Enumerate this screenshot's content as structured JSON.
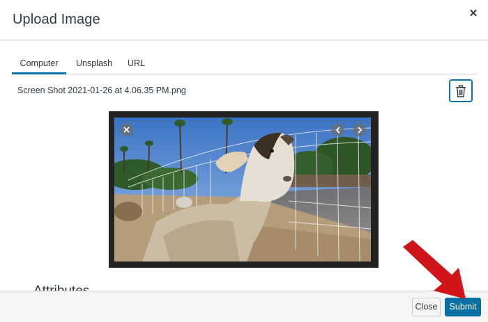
{
  "dialog": {
    "title": "Upload Image",
    "close_icon": "close-icon"
  },
  "tabs": [
    {
      "label": "Computer",
      "active": true
    },
    {
      "label": "Unsplash",
      "active": false
    },
    {
      "label": "URL",
      "active": false
    }
  ],
  "file": {
    "name": "Screen Shot 2021-01-26 at 4.06.35 PM.png",
    "delete_icon": "trash-icon"
  },
  "preview": {
    "controls": [
      "close-icon",
      "chevron-left-icon",
      "chevron-right-icon"
    ]
  },
  "section": {
    "heading": "Attributes"
  },
  "footer": {
    "close_label": "Close",
    "submit_label": "Submit"
  },
  "colors": {
    "accent": "#0770a3",
    "annotation_arrow": "#d0151a"
  }
}
